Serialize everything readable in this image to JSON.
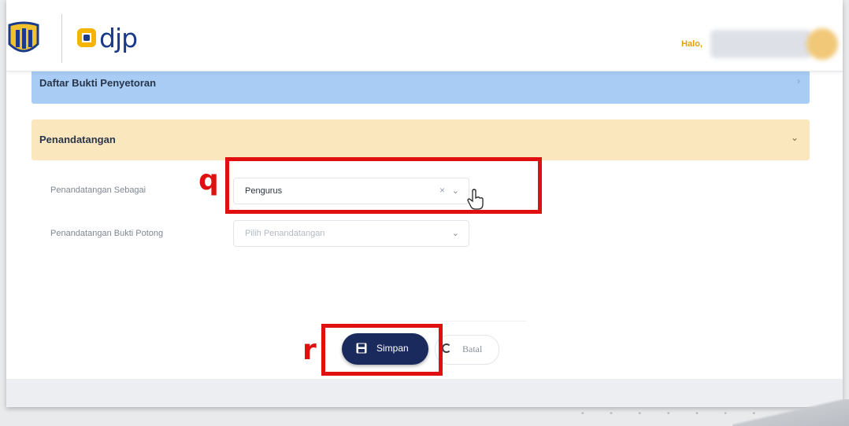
{
  "header": {
    "brand": "djp",
    "greeting": "Halo,"
  },
  "sections": {
    "deposit_proof_list": {
      "title": "Daftar Bukti Penyetoran"
    },
    "signing": {
      "title": "Penandatangan"
    }
  },
  "form": {
    "signer_as": {
      "label": "Penandatangan Sebagai",
      "value": "Pengurus",
      "clear_glyph": "×",
      "arrow_glyph": "⌄"
    },
    "withholding_slip_signer": {
      "label": "Penandatangan Bukti Potong",
      "placeholder": "Pilih Penandatangan",
      "arrow_glyph": "⌄"
    }
  },
  "actions": {
    "save_label": "Simpan",
    "cancel_label": "Batal"
  },
  "annotations": {
    "q": "q",
    "r": "r",
    "color": "#e01010"
  },
  "colors": {
    "primary_button": "#1b2a5c",
    "section_blue": "#a9ccf4",
    "section_yellow": "#fbe7bd",
    "brand_navy": "#1b3a8a",
    "brand_yellow": "#f4b400"
  },
  "icons": {
    "emblem": "ministry-emblem-icon",
    "save": "floppy-disk-icon",
    "cancel": "circle-arrow-icon",
    "cursor": "hand-pointer-icon"
  }
}
